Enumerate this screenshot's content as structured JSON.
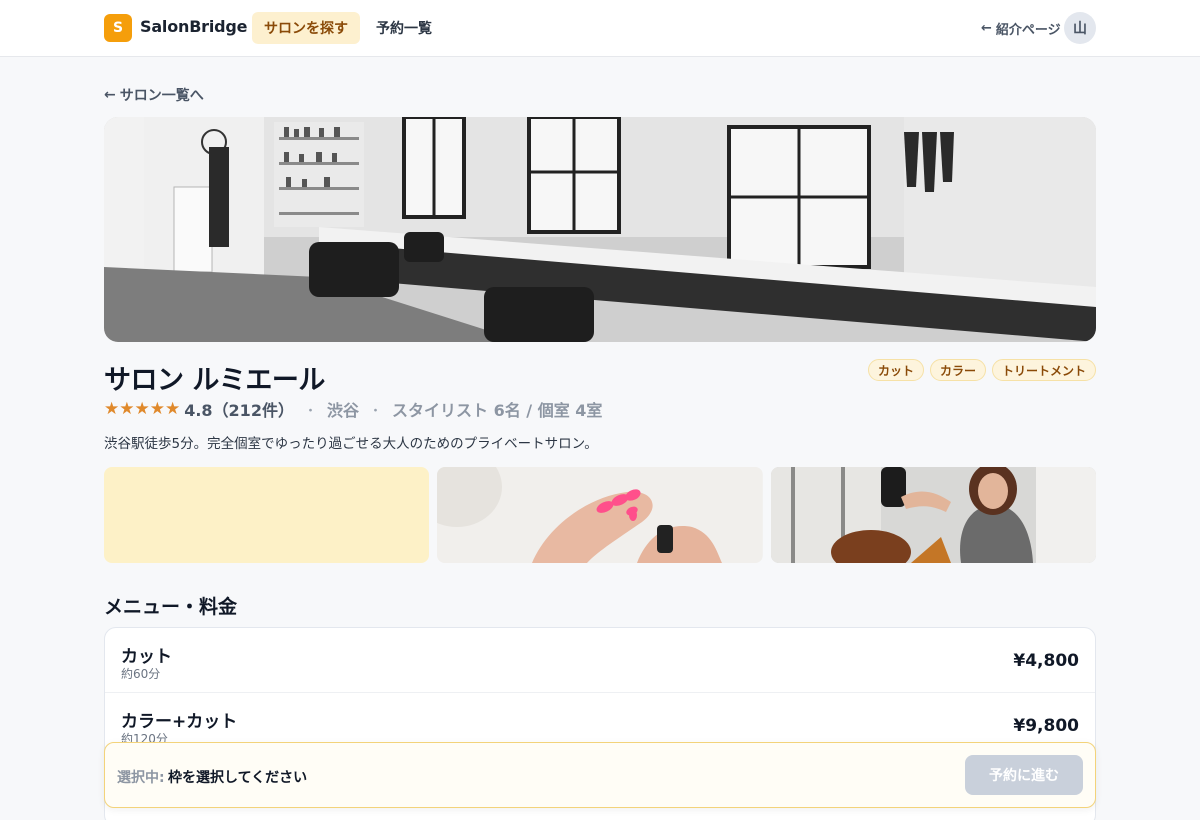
{
  "header": {
    "logo_letter": "S",
    "brand": "SalonBridge",
    "nav": {
      "search": "サロンを探す",
      "bookings": "予約一覧"
    },
    "intro_link": "紹介ページ",
    "avatar_text": "山"
  },
  "back_link": "サロン一覧へ",
  "salon": {
    "name": "サロン ルミエール",
    "tags": [
      "カット",
      "カラー",
      "トリートメント"
    ],
    "stars": "★★★★★",
    "rating": "4.8（212件）",
    "area": "渋谷",
    "capacity": "スタイリスト 6名 / 個室 4室",
    "description": "渋谷駅徒歩5分。完全個室でゆったり過ごせる大人のためのプライベートサロン。"
  },
  "menu": {
    "title": "メニュー・料金",
    "items": [
      {
        "name": "カット",
        "duration": "約60分",
        "price": "¥4,800"
      },
      {
        "name": "カラー+カット",
        "duration": "約120分",
        "price": "¥9,800"
      }
    ]
  },
  "selection": {
    "label": "選択中:",
    "value": "枠を選択してください",
    "button": "予約に進む"
  },
  "colors": {
    "accent": "#f59e0b",
    "accent_bg": "#fdf0cf",
    "star": "#e0892b",
    "disabled_button": "#c9d0db"
  }
}
